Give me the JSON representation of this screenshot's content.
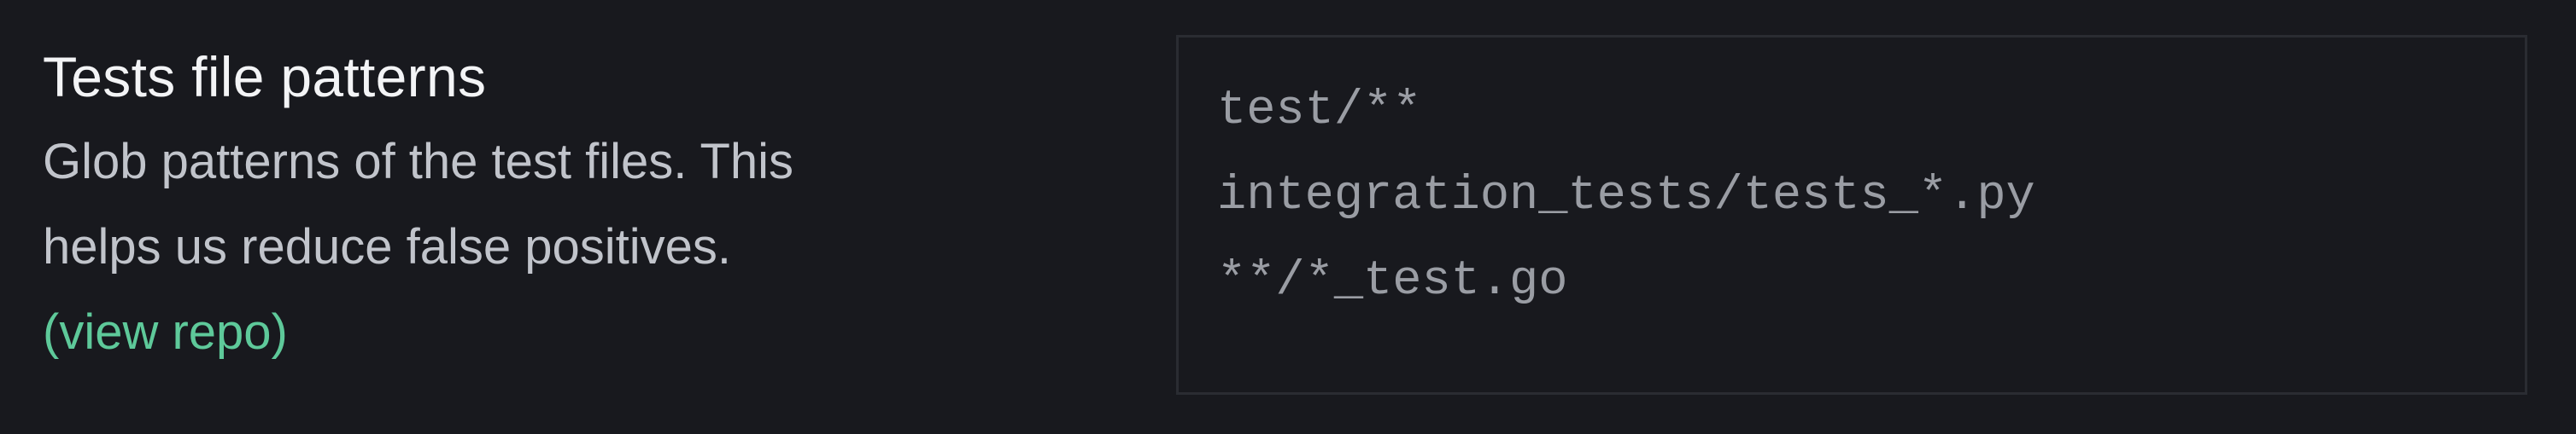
{
  "setting": {
    "title": "Tests file patterns",
    "description_line1": "Glob patterns of the test files. This",
    "description_line2": "helps us reduce false positives.",
    "link_label": "(view repo)"
  },
  "patterns": {
    "value": "test/**\nintegration_tests/tests_*.py\n**/*_test.go"
  },
  "colors": {
    "background": "#18191e",
    "title": "#f3f4f6",
    "description": "#c1c4cb",
    "link": "#5ec99a",
    "field_border": "#2a2c32",
    "field_text": "#9a9da4"
  }
}
